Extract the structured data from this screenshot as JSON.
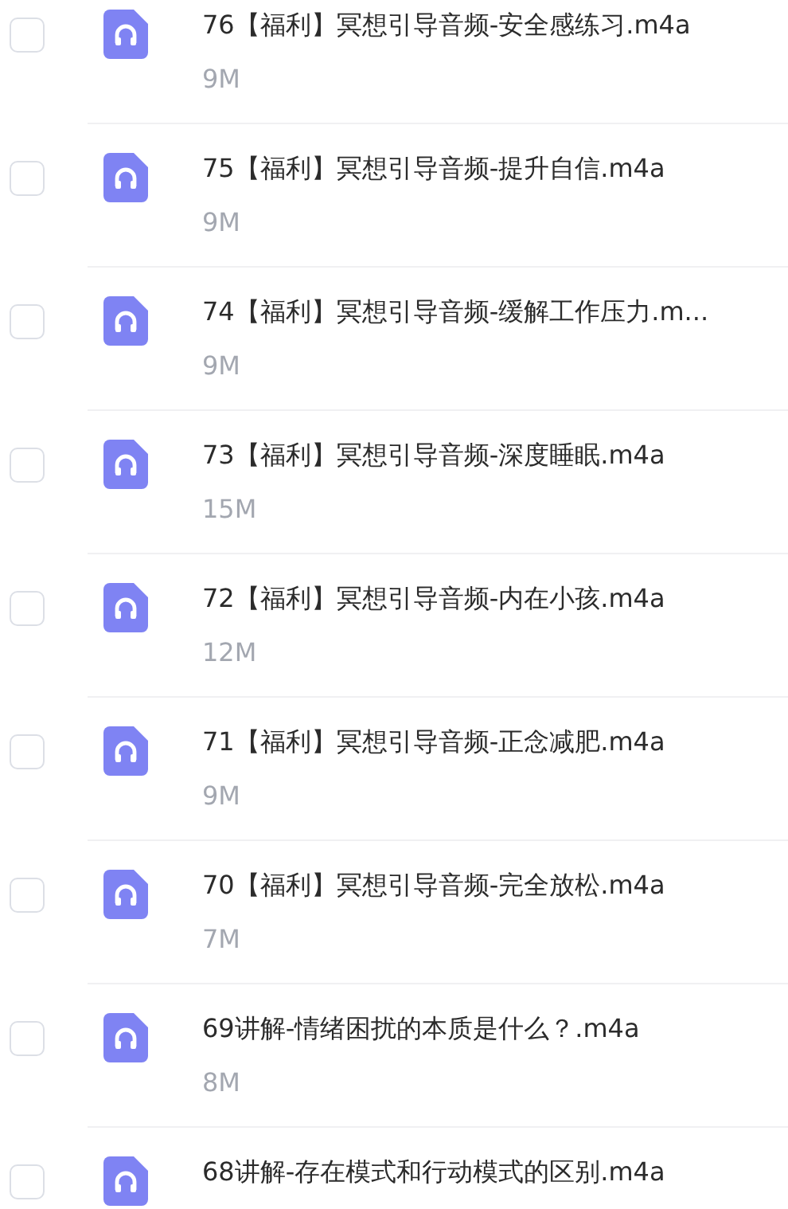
{
  "files": [
    {
      "name": "76【福利】冥想引导音频-安全感练习.m4a",
      "size": "9M",
      "checked": false
    },
    {
      "name": "75【福利】冥想引导音频-提升自信.m4a",
      "size": "9M",
      "checked": false
    },
    {
      "name": "74【福利】冥想引导音频-缓解工作压力.m...",
      "size": "9M",
      "checked": false
    },
    {
      "name": "73【福利】冥想引导音频-深度睡眠.m4a",
      "size": "15M",
      "checked": false
    },
    {
      "name": "72【福利】冥想引导音频-内在小孩.m4a",
      "size": "12M",
      "checked": false
    },
    {
      "name": "71【福利】冥想引导音频-正念减肥.m4a",
      "size": "9M",
      "checked": false
    },
    {
      "name": "70【福利】冥想引导音频-完全放松.m4a",
      "size": "7M",
      "checked": false
    },
    {
      "name": "69讲解-情绪困扰的本质是什么？.m4a",
      "size": "8M",
      "checked": false
    },
    {
      "name": "68讲解-存在模式和行动模式的区别.m4a",
      "checked": false
    }
  ]
}
